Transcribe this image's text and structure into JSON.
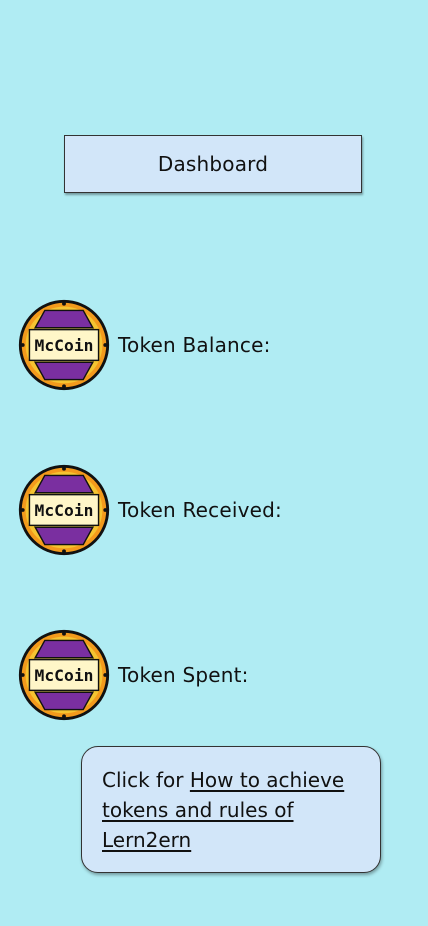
{
  "header": {
    "dashboard_label": "Dashboard"
  },
  "tokens": [
    {
      "coin_text": "McCoin",
      "label": "Token Balance:",
      "icon": "mccoin-icon"
    },
    {
      "coin_text": "McCoin",
      "label": "Token Received:",
      "icon": "mccoin-icon"
    },
    {
      "coin_text": "McCoin",
      "label": "Token Spent:",
      "icon": "mccoin-icon"
    }
  ],
  "rules_card": {
    "prefix": "Click for ",
    "link_text": "How to achieve tokens and rules of Lern2ern"
  },
  "colors": {
    "background": "#b0ecf3",
    "panel": "#d2e6f9",
    "coin_gold": "#f5c431",
    "coin_purple": "#7a2fa0"
  }
}
